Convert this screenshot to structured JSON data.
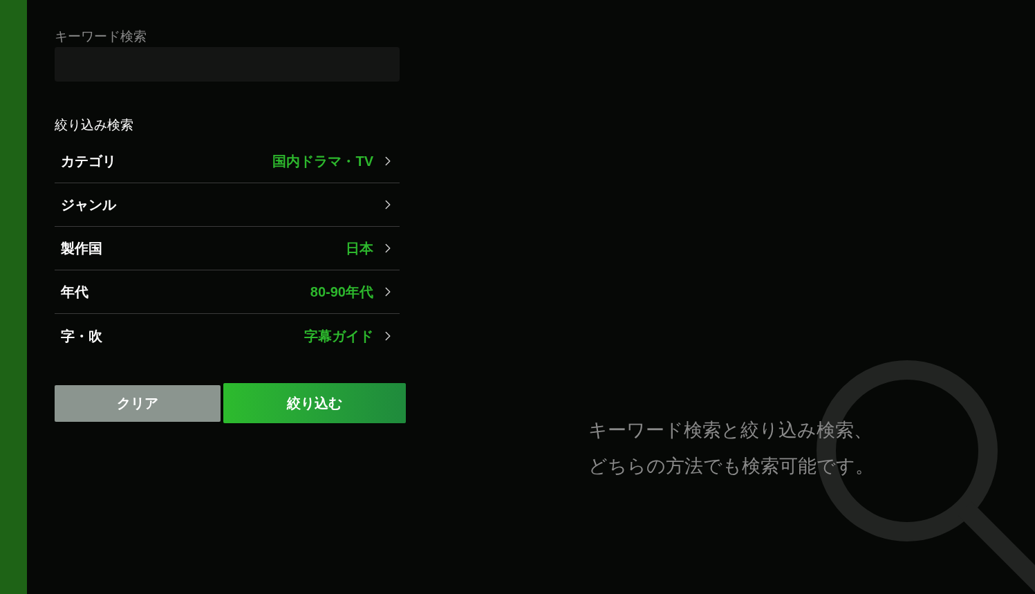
{
  "keyword_search": {
    "label": "キーワード検索"
  },
  "filter_search": {
    "heading": "絞り込み検索",
    "rows": [
      {
        "label": "カテゴリ",
        "value": "国内ドラマ・TV"
      },
      {
        "label": "ジャンル"
      },
      {
        "label": "製作国",
        "value": "日本"
      },
      {
        "label": "年代",
        "value": "80-90年代"
      },
      {
        "label": "字・吹",
        "value": "字幕ガイド"
      }
    ]
  },
  "buttons": [
    {
      "kind": "secondary",
      "label": "クリア"
    },
    {
      "kind": "primary",
      "label": "絞り込む"
    }
  ],
  "hint": [
    "キーワード検索と絞り込み検索、",
    "どちらの方法でも検索可能です。"
  ]
}
